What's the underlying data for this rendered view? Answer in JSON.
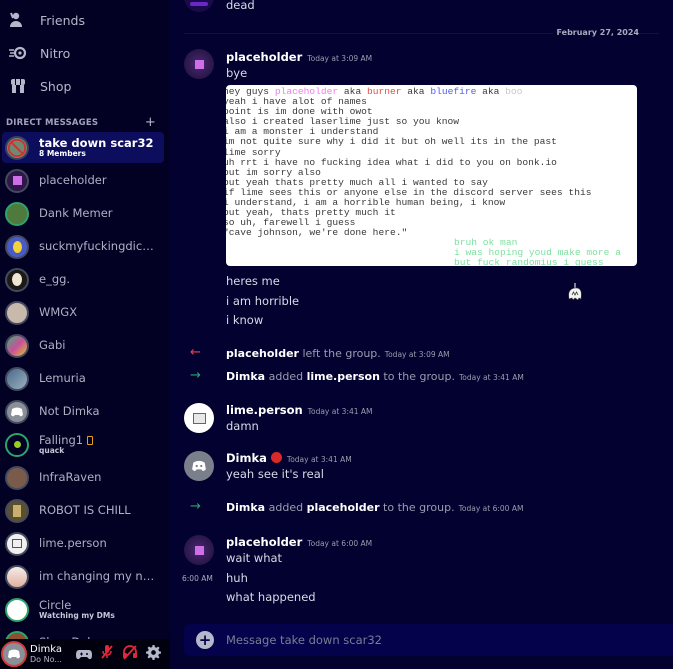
{
  "sidebar": {
    "nav": [
      {
        "label": "Friends",
        "icon": "friends-icon"
      },
      {
        "label": "Nitro",
        "icon": "nitro-icon"
      },
      {
        "label": "Shop",
        "icon": "shop-icon"
      }
    ],
    "dm_header": "DIRECT MESSAGES",
    "dm_add": "+",
    "dms": [
      {
        "name": "take down scar32",
        "sub": "8 Members",
        "active": true
      },
      {
        "name": "placeholder",
        "sub": ""
      },
      {
        "name": "Dank Memer",
        "sub": ""
      },
      {
        "name": "suckmyfuckingdickgr...",
        "sub": ""
      },
      {
        "name": "e_gg.",
        "sub": ""
      },
      {
        "name": "WMGX",
        "sub": ""
      },
      {
        "name": "Gabi",
        "sub": ""
      },
      {
        "name": "Lemuria",
        "sub": ""
      },
      {
        "name": "Not Dimka",
        "sub": ""
      },
      {
        "name": "Falling1",
        "sub": "quack"
      },
      {
        "name": "InfraRaven",
        "sub": ""
      },
      {
        "name": "ROBOT IS CHILL",
        "sub": ""
      },
      {
        "name": "lime.person",
        "sub": ""
      },
      {
        "name": "im changing my name...",
        "sub": ""
      },
      {
        "name": "Circle",
        "sub": "Watching my DMs"
      },
      {
        "name": "Slam Dab...",
        "sub": ""
      }
    ],
    "user": {
      "name": "Dimka",
      "status": "Do No..."
    }
  },
  "chat": {
    "prev_message": "dead",
    "date_divider": "February 27, 2024",
    "messages": [
      {
        "author": "placeholder",
        "timestamp": "Today at 3:09 AM",
        "lines": [
          "bye"
        ],
        "attachment_lines": [
          "hey guys placeholder aka burner aka bluefire aka boo",
          "yeah i have alot of names",
          "point is im done with owot",
          "also i created laserlime just so you know",
          "i am a monster i understand",
          "im not quite sure why i did it but oh well its in the past",
          "lime sorry",
          "uh rrt i have no fucking idea what i did to you on bonk.io",
          "but im sorry also",
          "but yeah thats pretty much all i wanted to say",
          "if lime sees this or anyone else in the discord server sees this",
          "i understand, i am a horrible human being, i know",
          "but yeah, thats pretty much it",
          "so uh, farewell i guess",
          "\"cave johnson, we're done here.\""
        ],
        "attachment_green_lines": [
          "bruh ok man",
          "i was hoping youd make more a",
          "but fuck randomius i guess"
        ],
        "after_lines": [
          "heres me",
          "i am horrible",
          "i know"
        ]
      }
    ],
    "system1": {
      "actor": "placeholder",
      "text": "left the group.",
      "timestamp": "Today at 3:09 AM"
    },
    "system2": {
      "actor": "Dimka",
      "verb": "added",
      "target": "lime.person",
      "text": "to the group.",
      "timestamp": "Today at 3:41 AM"
    },
    "lime_msg": {
      "author": "lime.person",
      "timestamp": "Today at 3:41 AM",
      "text": "damn"
    },
    "dimka_msg": {
      "author": "Dimka",
      "timestamp": "Today at 3:41 AM",
      "text": "yeah see it's real"
    },
    "system3": {
      "actor": "Dimka",
      "verb": "added",
      "target": "placeholder",
      "text": "to the group.",
      "timestamp": "Today at 6:00 AM"
    },
    "last_msg": {
      "author": "placeholder",
      "timestamp": "Today at 6:00 AM",
      "hover_ts": "6:00 AM",
      "lines": [
        "wait what",
        "huh",
        "what happened"
      ]
    },
    "composer_placeholder": "Message take down scar32"
  },
  "colors": {
    "background": "#02012f",
    "sidebar": "#020124",
    "active_dm": "#0d0d5e",
    "composer": "#04024a",
    "leave_arrow": "#e0484e",
    "join_arrow": "#2fa36b"
  }
}
